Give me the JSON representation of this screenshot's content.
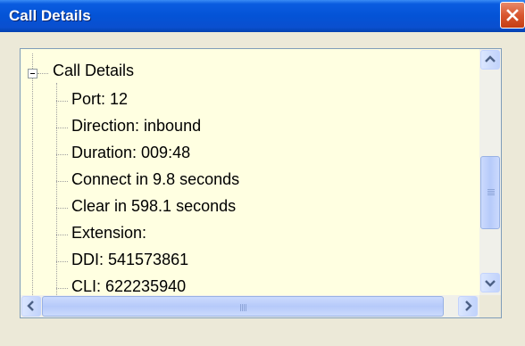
{
  "window": {
    "title": "Call Details",
    "title_bar_color": "#0453d6",
    "close_button_color": "#d9572f"
  },
  "tree": {
    "background_color": "#ffffe1",
    "root": {
      "label": "Call Details",
      "expanded": true
    },
    "children": [
      {
        "label": "Port:  12"
      },
      {
        "label": "Direction:  inbound"
      },
      {
        "label": "Duration:  009:48"
      },
      {
        "label": "Connect in 9.8 seconds"
      },
      {
        "label": "Clear in 598.1 seconds"
      },
      {
        "label": "Extension:"
      },
      {
        "label": "DDI:  541573861"
      },
      {
        "label": "CLI:  622235940"
      }
    ]
  },
  "scrollbars": {
    "vertical": {
      "position_fraction": 0.55,
      "visible_fraction": 0.3
    },
    "horizontal": {
      "position_fraction": 0.0,
      "visible_fraction": 0.92
    }
  }
}
